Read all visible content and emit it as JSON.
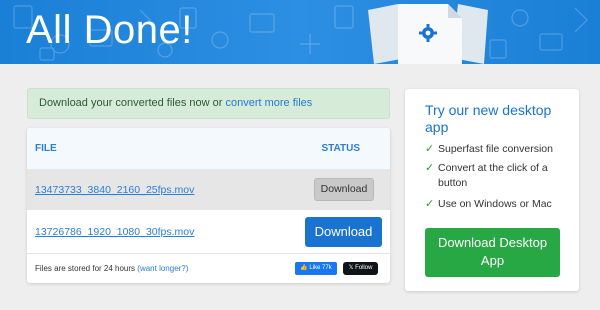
{
  "banner": {
    "title": "All Done!"
  },
  "notice": {
    "text": "Download your converted files now or ",
    "link": "convert more files"
  },
  "table": {
    "headers": {
      "file": "FILE",
      "status": "STATUS"
    },
    "rows": [
      {
        "filename": "13473733_3840_2160_25fps.mov",
        "action": "Download"
      },
      {
        "filename": "13726786_1920_1080_30fps.mov",
        "action": "Download"
      }
    ]
  },
  "footer": {
    "text": "Files are stored for 24 hours ",
    "link": "(want longer?)",
    "fb_like": "👍 Like 77k",
    "x_follow": "𝕏 Follow"
  },
  "promo": {
    "title": "Try our new desktop app",
    "features": [
      "Superfast file conversion",
      "Convert at the click of a button",
      "Use on Windows or Mac"
    ],
    "check": "✓",
    "button": "Download Desktop App"
  },
  "colors": {
    "accent": "#1a73d1",
    "success": "#28a745",
    "banner": "#2d8fe2"
  },
  "icons": {
    "docs": "gear-document-icon"
  }
}
